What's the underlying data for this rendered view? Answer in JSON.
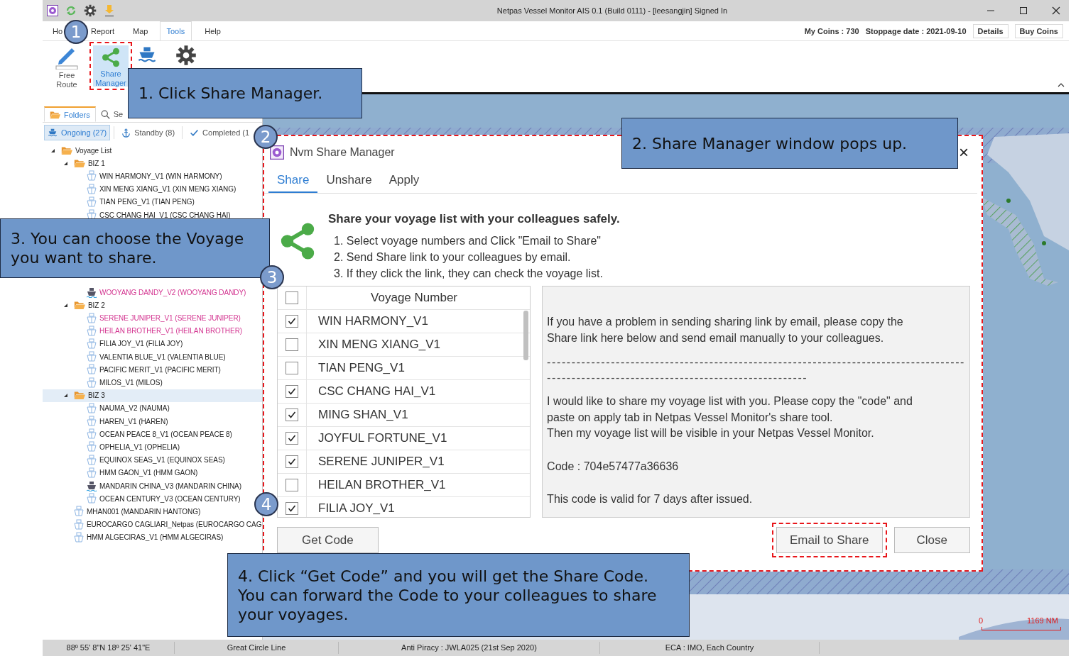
{
  "window": {
    "title": "Netpas Vessel Monitor AIS 0.1 (Build 0111) - [leesangjin] Signed In"
  },
  "menu_tabs": [
    {
      "label": "Ho",
      "selected": false
    },
    {
      "label": "Report",
      "selected": false
    },
    {
      "label": "Map",
      "selected": false
    },
    {
      "label": "Tools",
      "selected": true
    },
    {
      "label": "Help",
      "selected": false
    }
  ],
  "account": {
    "coins": "My Coins : 730",
    "stoppage": "Stoppage date : 2021-09-10",
    "buttons": [
      "Details",
      "Buy Coins"
    ]
  },
  "ribbon": [
    {
      "kind": "pencil",
      "label": "Free Route",
      "selected": false,
      "highlighted": false
    },
    {
      "kind": "share",
      "label": "Share Manager",
      "selected": true,
      "highlighted": true
    },
    {
      "kind": "ship",
      "selected": false,
      "highlighted": false
    },
    {
      "kind": "gear",
      "selected": false,
      "highlighted": false
    }
  ],
  "side_tabs": [
    {
      "kind": "folder",
      "label": "Folders",
      "selected": true
    },
    {
      "kind": "search",
      "label": "Se",
      "selected": false
    }
  ],
  "filters": [
    {
      "kind": "ship",
      "label": "Ongoing (27)",
      "selected": true
    },
    {
      "kind": "anchor",
      "label": "Standby (8)",
      "selected": false
    },
    {
      "kind": "check",
      "label": "Completed (1",
      "selected": false
    }
  ],
  "tree": {
    "kind": "folder",
    "label": "Voyage List",
    "expanded": true,
    "selected": false,
    "children": [
      {
        "kind": "folder",
        "label": "BIZ 1",
        "expanded": true,
        "selected": false,
        "children": [
          {
            "kind": "planned",
            "label": "WIN HARMONY_V1 (WIN HARMONY)",
            "alert": false,
            "selected": false
          },
          {
            "kind": "planned",
            "label": "XIN MENG XIANG_V1 (XIN MENG XIANG)",
            "alert": false,
            "selected": false
          },
          {
            "kind": "planned",
            "label": "TIAN PENG_V1 (TIAN PENG)",
            "alert": false,
            "selected": false
          },
          {
            "kind": "planned",
            "label": "CSC CHANG HAI_V1 (CSC CHANG HAI)",
            "alert": false,
            "selected": false
          },
          {
            "kind": "sailing",
            "label": "WOOYANG DANDY_V2 (WOOYANG DANDY)",
            "alert": true,
            "selected": false
          }
        ]
      },
      {
        "kind": "folder",
        "label": "BIZ 2",
        "expanded": true,
        "selected": false,
        "children": [
          {
            "kind": "planned",
            "label": "SERENE JUNIPER_V1 (SERENE JUNIPER)",
            "alert": true,
            "selected": false
          },
          {
            "kind": "planned",
            "label": "HEILAN BROTHER_V1 (HEILAN BROTHER)",
            "alert": true,
            "selected": false
          },
          {
            "kind": "planned",
            "label": "FILIA JOY_V1 (FILIA JOY)",
            "alert": false,
            "selected": false
          },
          {
            "kind": "planned",
            "label": "VALENTIA BLUE_V1 (VALENTIA BLUE)",
            "alert": false,
            "selected": false
          },
          {
            "kind": "planned",
            "label": "PACIFIC MERIT_V1 (PACIFIC MERIT)",
            "alert": false,
            "selected": false
          },
          {
            "kind": "planned",
            "label": "MILOS_V1 (MILOS)",
            "alert": false,
            "selected": false
          }
        ]
      },
      {
        "kind": "folder",
        "label": "BIZ 3",
        "expanded": true,
        "selected": true,
        "children": [
          {
            "kind": "planned",
            "label": "NAUMA_V2 (NAUMA)",
            "alert": false,
            "selected": false
          },
          {
            "kind": "planned",
            "label": "HAREN_V1 (HAREN)",
            "alert": false,
            "selected": false
          },
          {
            "kind": "planned",
            "label": "OCEAN PEACE 8_V1 (OCEAN PEACE 8)",
            "alert": false,
            "selected": false
          },
          {
            "kind": "planned",
            "label": "OPHELIA_V1 (OPHELIA)",
            "alert": false,
            "selected": false
          },
          {
            "kind": "planned",
            "label": "EQUINOX SEAS_V1 (EQUINOX SEAS)",
            "alert": false,
            "selected": false
          },
          {
            "kind": "planned",
            "label": "HMM GAON_V1 (HMM GAON)",
            "alert": false,
            "selected": false
          },
          {
            "kind": "sailing",
            "label": "MANDARIN CHINA_V3 (MANDARIN CHINA)",
            "alert": false,
            "selected": false
          },
          {
            "kind": "planned",
            "label": "OCEAN CENTURY_V3 (OCEAN CENTURY)",
            "alert": false,
            "selected": false
          }
        ]
      },
      {
        "kind": "planned",
        "label": "MHAN001 (MANDARIN HANTONG)",
        "alert": false,
        "selected": false
      },
      {
        "kind": "planned",
        "label": "EUROCARGO CAGLIARI_Netpas (EUROCARGO CAG",
        "alert": false,
        "selected": false
      },
      {
        "kind": "planned",
        "label": "HMM ALGECIRAS_V1 (HMM ALGECIRAS)",
        "alert": false,
        "selected": false
      }
    ]
  },
  "map": {
    "scale_start": "0",
    "scale_end": "1169 NM"
  },
  "dialog": {
    "title": "Nvm Share Manager",
    "close": "×",
    "tabs": [
      {
        "label": "Share",
        "selected": true
      },
      {
        "label": "Unshare",
        "selected": false
      },
      {
        "label": "Apply",
        "selected": false
      }
    ],
    "heading": "Share your voyage list with your colleagues safely.",
    "steps": [
      "1. Select voyage numbers and Click \"Email to Share\"",
      "2. Send Share link to your colleagues by email.",
      "3. If they click the link, they can check the voyage list."
    ],
    "table": {
      "header_checked": false,
      "column": "Voyage Number",
      "rows": [
        {
          "voyage": "WIN HARMONY_V1",
          "checked": true
        },
        {
          "voyage": "XIN MENG XIANG_V1",
          "checked": false
        },
        {
          "voyage": "TIAN PENG_V1",
          "checked": false
        },
        {
          "voyage": "CSC CHANG HAI_V1",
          "checked": true
        },
        {
          "voyage": "MING SHAN_V1",
          "checked": true
        },
        {
          "voyage": "JOYFUL FORTUNE_V1",
          "checked": true
        },
        {
          "voyage": "SERENE JUNIPER_V1",
          "checked": true
        },
        {
          "voyage": "HEILAN BROTHER_V1",
          "checked": false
        },
        {
          "voyage": "FILIA JOY_V1",
          "checked": true
        }
      ]
    },
    "note": {
      "intro": "If you have a problem in sending sharing link by email, please copy the Share link here below and send email manually to your colleagues.",
      "separators": [
        "-------------------------------------------------------------------------------------",
        "-----------------------------------------------------"
      ],
      "message": [
        "I would like to share my voyage list with you. Please copy the \"code\" and paste on apply tab in Netpas Vessel Monitor's share tool.",
        "Then my voyage list will be visible in your Netpas Vessel Monitor."
      ],
      "code": "Code : 704e57477a36636",
      "validity": "This code is valid for 7 days after issued."
    },
    "buttons": [
      {
        "label": "Get Code",
        "highlighted": false
      },
      {
        "label": "Email to Share",
        "highlighted": true
      },
      {
        "label": "Close",
        "highlighted": false
      }
    ]
  },
  "callouts": [
    {
      "number": "1",
      "text": "1. Click Share Manager."
    },
    {
      "number": "2",
      "text": "2. Share Manager window pops up."
    },
    {
      "number": "3",
      "text": "3. You can choose the Voyage you want to share."
    },
    {
      "number": "4",
      "text": "4. Click “Get Code” and you will get the Share Code. You can forward the Code to your colleagues to share your voyages."
    }
  ],
  "status_bar": [
    "88º 55' 8\"N 18º 25' 41\"E",
    "Great Circle Line",
    "Anti Piracy : JWLA025 (21st Sep 2020)",
    "ECA : IMO, Each Country"
  ]
}
